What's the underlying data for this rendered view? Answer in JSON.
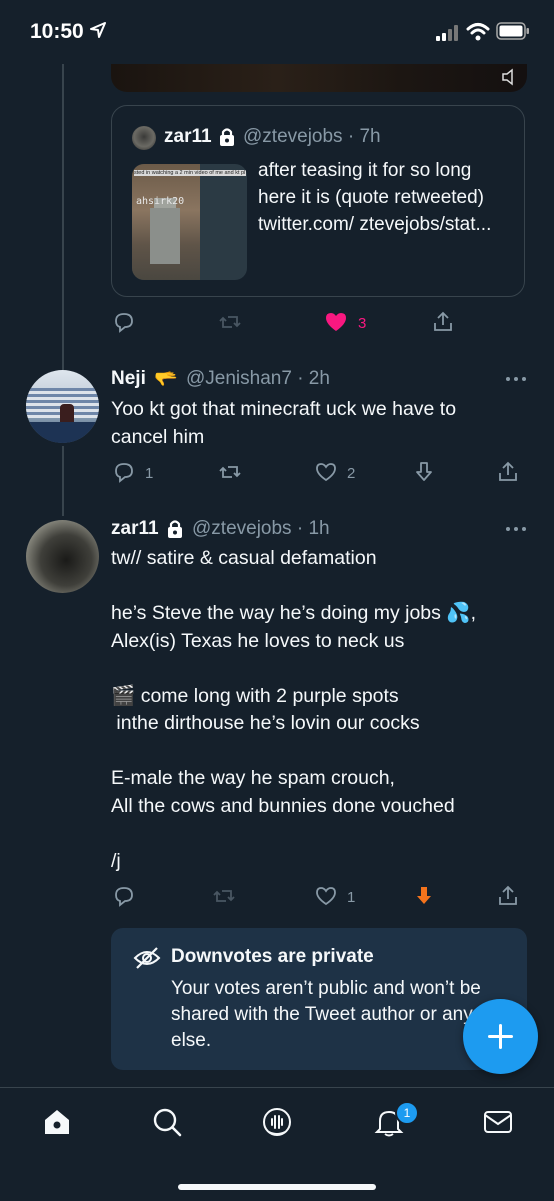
{
  "status_bar": {
    "time": "10:50"
  },
  "quoted_tweet": {
    "name": "zar11",
    "handle_time": "@ztevejobs · 7h",
    "thumbnail_caption": "sted in watching a 2 min video of me and kt pl",
    "thumbnail_tag": "ahsirk20",
    "text": "after teasing it for so long here it is (quote retweeted) twitter.com/ ztevejobs/stat..."
  },
  "tweet0_actions": {
    "likes": "3"
  },
  "tweet1": {
    "name": "Neji",
    "name_emoji": "🫳",
    "handle_time": "@Jenishan7 · 2h",
    "text": "Yoo kt got that minecraft uck we have to cancel him",
    "replies": "1",
    "likes": "2"
  },
  "tweet2": {
    "name": "zar11",
    "handle_time": "@ztevejobs · 1h",
    "text": "tw// satire & casual defamation\n\nhe’s Steve the way he’s doing my jobs 💦,\nAlex(is) Texas he loves to neck us\n\n🎬 come long with 2 purple spots\n inthe dirthouse he’s lovin our cocks\n\nE-male the way he spam crouch,\nAll the cows and bunnies done vouched\n\n/j",
    "likes": "1"
  },
  "downvote_notice": {
    "title": "Downvotes are private",
    "body": "Your votes aren’t public and won’t be shared with the Tweet author or anyone else."
  },
  "bottom_nav": {
    "notifications_badge": "1"
  },
  "colors": {
    "background": "#15202b",
    "accent": "#1d9bf0",
    "like": "#f91880",
    "downvote": "#f4731c",
    "muted": "#8899a6"
  }
}
